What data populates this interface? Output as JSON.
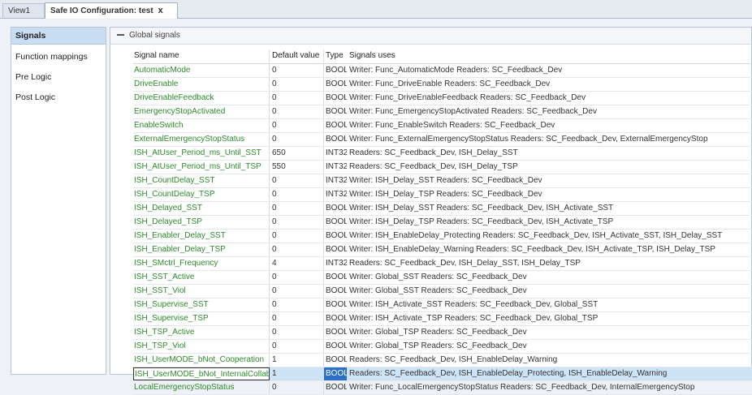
{
  "tabs": [
    {
      "label": "View1",
      "close": ""
    },
    {
      "label": "Safe IO Configuration: test",
      "close": "x"
    }
  ],
  "sidebar": {
    "items": [
      "Signals",
      "Function mappings",
      "Pre Logic",
      "Post Logic"
    ]
  },
  "group": {
    "title": "Global signals",
    "collapse_icon": "minus-icon"
  },
  "table": {
    "headers": [
      "Signal name",
      "Default value",
      "Type",
      "Signals uses"
    ],
    "rows": [
      [
        "AutomaticMode",
        "0",
        "BOOL",
        "Writer: Func_AutomaticMode Readers: SC_Feedback_Dev"
      ],
      [
        "DriveEnable",
        "0",
        "BOOL",
        "Writer: Func_DriveEnable Readers: SC_Feedback_Dev"
      ],
      [
        "DriveEnableFeedback",
        "0",
        "BOOL",
        "Writer: Func_DriveEnableFeedback Readers: SC_Feedback_Dev"
      ],
      [
        "EmergencyStopActivated",
        "0",
        "BOOL",
        "Writer: Func_EmergencyStopActivated Readers: SC_Feedback_Dev"
      ],
      [
        "EnableSwitch",
        "0",
        "BOOL",
        "Writer: Func_EnableSwitch Readers: SC_Feedback_Dev"
      ],
      [
        "ExternalEmergencyStopStatus",
        "0",
        "BOOL",
        "Writer: Func_ExternalEmergencyStopStatus Readers: SC_Feedback_Dev, ExternalEmergencyStop"
      ],
      [
        "ISH_AtUser_Period_ms_Until_SST",
        "650",
        "INT32",
        "Readers: SC_Feedback_Dev, ISH_Delay_SST"
      ],
      [
        "ISH_AtUser_Period_ms_Until_TSP",
        "550",
        "INT32",
        "Readers: SC_Feedback_Dev, ISH_Delay_TSP"
      ],
      [
        "ISH_CountDelay_SST",
        "0",
        "INT32",
        "Writer: ISH_Delay_SST Readers: SC_Feedback_Dev"
      ],
      [
        "ISH_CountDelay_TSP",
        "0",
        "INT32",
        "Writer: ISH_Delay_TSP Readers: SC_Feedback_Dev"
      ],
      [
        "ISH_Delayed_SST",
        "0",
        "BOOL",
        "Writer: ISH_Delay_SST Readers: SC_Feedback_Dev, ISH_Activate_SST"
      ],
      [
        "ISH_Delayed_TSP",
        "0",
        "BOOL",
        "Writer: ISH_Delay_TSP Readers: SC_Feedback_Dev, ISH_Activate_TSP"
      ],
      [
        "ISH_Enabler_Delay_SST",
        "0",
        "BOOL",
        "Writer: ISH_EnableDelay_Protecting Readers: SC_Feedback_Dev, ISH_Activate_SST, ISH_Delay_SST"
      ],
      [
        "ISH_Enabler_Delay_TSP",
        "0",
        "BOOL",
        "Writer: ISH_EnableDelay_Warning Readers: SC_Feedback_Dev, ISH_Activate_TSP, ISH_Delay_TSP"
      ],
      [
        "ISH_SMctrl_Frequency",
        "4",
        "INT32",
        "Readers: SC_Feedback_Dev, ISH_Delay_SST, ISH_Delay_TSP"
      ],
      [
        "ISH_SST_Active",
        "0",
        "BOOL",
        "Writer: Global_SST Readers: SC_Feedback_Dev"
      ],
      [
        "ISH_SST_Viol",
        "0",
        "BOOL",
        "Writer: Global_SST Readers: SC_Feedback_Dev"
      ],
      [
        "ISH_Supervise_SST",
        "0",
        "BOOL",
        "Writer: ISH_Activate_SST Readers: SC_Feedback_Dev, Global_SST"
      ],
      [
        "ISH_Supervise_TSP",
        "0",
        "BOOL",
        "Writer: ISH_Activate_TSP Readers: SC_Feedback_Dev, Global_TSP"
      ],
      [
        "ISH_TSP_Active",
        "0",
        "BOOL",
        "Writer: Global_TSP Readers: SC_Feedback_Dev"
      ],
      [
        "ISH_TSP_Viol",
        "0",
        "BOOL",
        "Writer: Global_TSP Readers: SC_Feedback_Dev"
      ],
      [
        "ISH_UserMODE_bNot_Cooperation",
        "1",
        "BOOL",
        "Readers: SC_Feedback_Dev, ISH_EnableDelay_Warning"
      ],
      [
        "ISH_UserMODE_bNot_InternalCollab",
        "1",
        "BOOL",
        "Readers: SC_Feedback_Dev, ISH_EnableDelay_Protecting, ISH_EnableDelay_Warning"
      ],
      [
        "LocalEmergencyStopStatus",
        "0",
        "BOOL",
        "Writer: Func_LocalEmergencyStopStatus Readers: SC_Feedback_Dev, InternalEmergencyStop"
      ]
    ]
  },
  "colors": {
    "signal_name": "#2e8a2e",
    "selection": "#cfe3f7",
    "accent": "#2b70c9"
  }
}
